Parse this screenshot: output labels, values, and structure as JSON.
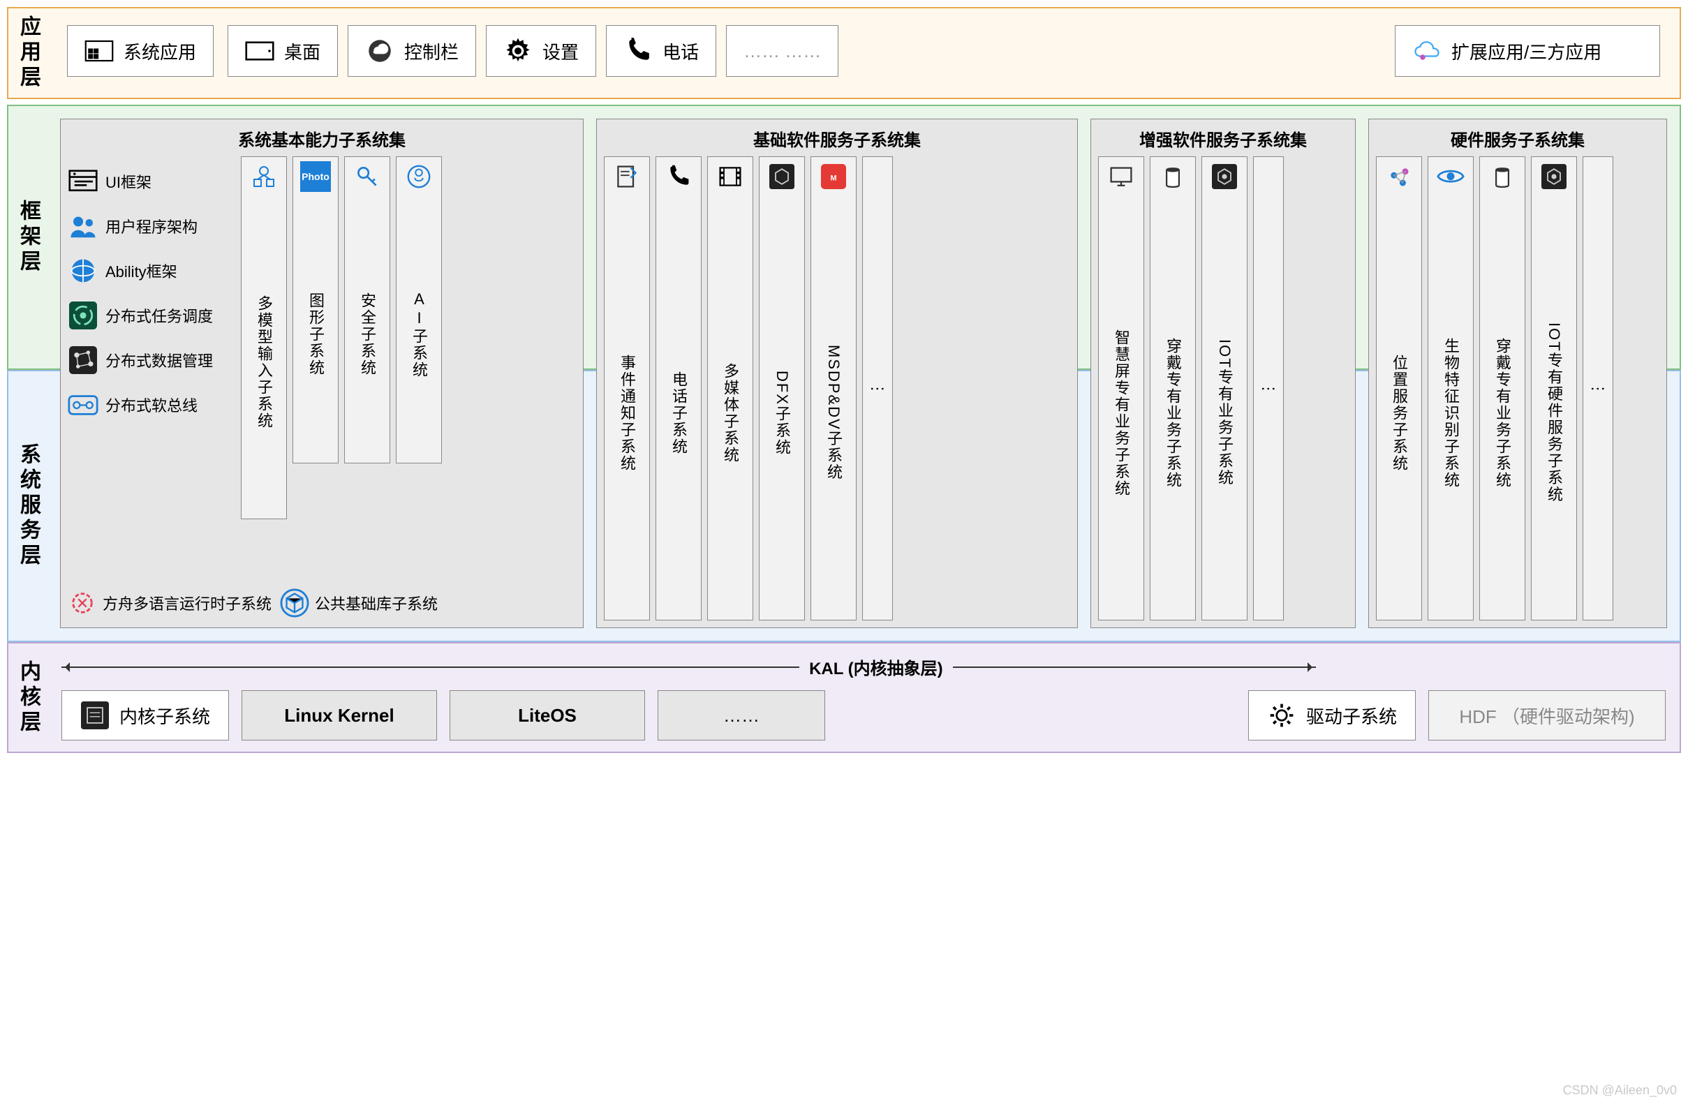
{
  "layers": {
    "application": {
      "label": "应用层"
    },
    "framework": {
      "label": "框架层"
    },
    "service": {
      "label": "系统服务层"
    },
    "kernel": {
      "label": "内核层"
    }
  },
  "application": {
    "system_apps": "系统应用",
    "desktop": "桌面",
    "control_bar": "控制栏",
    "settings": "设置",
    "phone": "电话",
    "more": "…… ……",
    "extended": "扩展应用/三方应用"
  },
  "groups": {
    "basic_capability": "系统基本能力子系统集",
    "basic_software": "基础软件服务子系统集",
    "enhanced_software": "增强软件服务子系统集",
    "hardware_service": "硬件服务子系统集"
  },
  "left_stack": {
    "ui_framework": "UI框架",
    "user_program": "用户程序架构",
    "ability": "Ability框架",
    "dist_sched": "分布式任务调度",
    "dist_data": "分布式数据管理",
    "dist_bus": "分布式软总线",
    "ark": "方舟多语言运行时子系统",
    "common_lib": "公共基础库子系统"
  },
  "cols": {
    "basic_capability": [
      {
        "id": "multimodal",
        "text": "多模型输入子系统",
        "icon": "multimodal-icon"
      },
      {
        "id": "graphics",
        "text": "图形子系统",
        "icon": "photo-icon",
        "label": "Photo"
      },
      {
        "id": "security",
        "text": "安全子系统",
        "icon": "key-icon"
      },
      {
        "id": "ai",
        "text": "AI子系统",
        "icon": "brain-icon"
      }
    ],
    "basic_software": [
      {
        "id": "event",
        "text": "事件通知子系统",
        "icon": "note-icon"
      },
      {
        "id": "telephony",
        "text": "电话子系统",
        "icon": "phone-icon"
      },
      {
        "id": "multimedia",
        "text": "多媒体子系统",
        "icon": "film-icon"
      },
      {
        "id": "dfx",
        "text": "DFX子系统",
        "icon": "cube-icon",
        "mixed": true
      },
      {
        "id": "msdp",
        "text": "MSDP&DV子系统",
        "icon": "msdp-icon",
        "mixed": true
      }
    ],
    "enhanced_software": [
      {
        "id": "smartscreen",
        "text": "智慧屏专有业务子系统",
        "icon": "monitor-icon"
      },
      {
        "id": "wearable_biz",
        "text": "穿戴专有业务子系统",
        "icon": "jar-icon"
      },
      {
        "id": "iot_biz",
        "text": "IOT专有业务子系统",
        "icon": "hex-icon",
        "mixed": true
      }
    ],
    "hardware_service": [
      {
        "id": "location",
        "text": "位置服务子系统",
        "icon": "pin-icon"
      },
      {
        "id": "biometric",
        "text": "生物特征识别子系统",
        "icon": "eye-icon"
      },
      {
        "id": "wearable_hw",
        "text": "穿戴专有业务子系统",
        "icon": "jar-icon"
      },
      {
        "id": "iot_hw",
        "text": "IOT专有硬件服务子系统",
        "icon": "hex-icon",
        "mixed": true
      }
    ],
    "ellipsis": "⋮"
  },
  "kernel": {
    "kal": "KAL (内核抽象层)",
    "kernel_sub": "内核子系统",
    "linux": "Linux Kernel",
    "liteos": "LiteOS",
    "more": "……",
    "driver_sub": "驱动子系统",
    "hdf": "HDF （硬件驱动架构)"
  },
  "watermark": "CSDN @Aileen_0v0"
}
